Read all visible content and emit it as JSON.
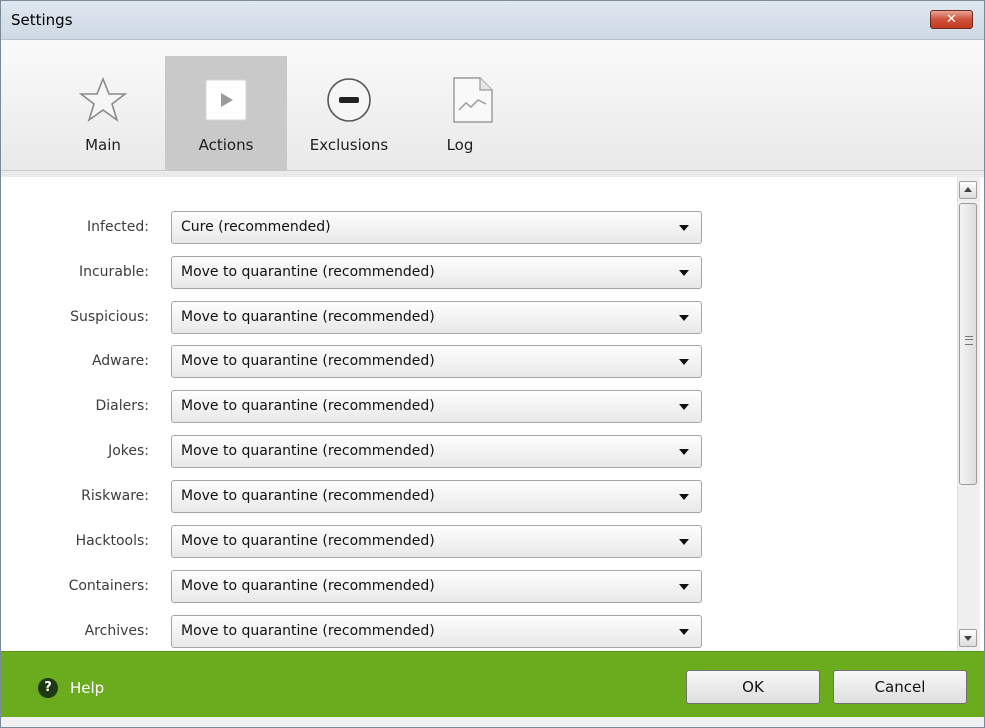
{
  "window": {
    "title": "Settings",
    "close_glyph": "✕"
  },
  "tabs": [
    {
      "label": "Main",
      "icon": "star-icon",
      "active": false
    },
    {
      "label": "Actions",
      "icon": "play-icon",
      "active": true
    },
    {
      "label": "Exclusions",
      "icon": "minus-circle-icon",
      "active": false
    },
    {
      "label": "Log",
      "icon": "log-document-icon",
      "active": false
    }
  ],
  "actions": [
    {
      "label": "Infected:",
      "value": "Cure (recommended)"
    },
    {
      "label": "Incurable:",
      "value": "Move to quarantine (recommended)"
    },
    {
      "label": "Suspicious:",
      "value": "Move to quarantine (recommended)"
    },
    {
      "label": "Adware:",
      "value": "Move to quarantine (recommended)"
    },
    {
      "label": "Dialers:",
      "value": "Move to quarantine (recommended)"
    },
    {
      "label": "Jokes:",
      "value": "Move to quarantine (recommended)"
    },
    {
      "label": "Riskware:",
      "value": "Move to quarantine (recommended)"
    },
    {
      "label": "Hacktools:",
      "value": "Move to quarantine (recommended)"
    },
    {
      "label": "Containers:",
      "value": "Move to quarantine (recommended)"
    },
    {
      "label": "Archives:",
      "value": "Move to quarantine (recommended)"
    }
  ],
  "footer": {
    "help_label": "Help",
    "help_glyph": "?",
    "ok_label": "OK",
    "cancel_label": "Cancel"
  },
  "colors": {
    "footer_bg": "#6aac1e",
    "active_tab_bg": "#c9c9c9",
    "close_button": "#c23a22"
  }
}
